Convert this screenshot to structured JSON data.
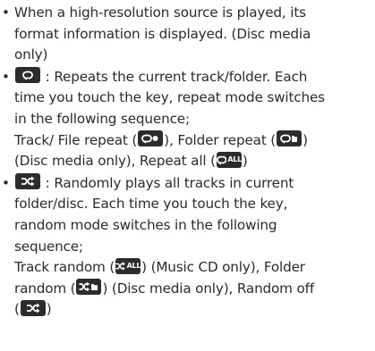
{
  "bullet_char": "•",
  "items": [
    {
      "lines": [
        "When a high-resolution source is played, its",
        "format information is displayed. (Disc media",
        "only)"
      ]
    },
    {
      "line1_after": " : Repeats the current track/folder. Each",
      "line2": "time you touch the key, repeat mode switches",
      "line3": "in the following sequence;",
      "line4_a": "Track/ File repeat (",
      "line4_b": "), Folder repeat (",
      "line4_c": ")",
      "line5_a": "(Disc media only), Repeat all (",
      "line5_b": ")",
      "key_text_all": "ALL"
    },
    {
      "line1_after": " : Randomly plays all tracks in current",
      "line2": "folder/disc. Each time you touch the key,",
      "line3": "random mode switches in the following",
      "line4": "sequence;",
      "line5_a": "Track random (",
      "line5_b": ") (Music CD only), Folder",
      "line6_a": "random (",
      "line6_b": ") (Disc media only), Random off",
      "line7_a": "(",
      "line7_b": ")",
      "key_text_all": "ALL"
    }
  ],
  "icons": {
    "repeat": "repeat-icon",
    "repeat_one": "repeat-one-icon",
    "repeat_folder": "repeat-folder-icon",
    "repeat_all": "repeat-all-icon",
    "random": "random-icon",
    "random_all": "random-all-icon",
    "random_folder": "random-folder-icon",
    "random_off": "random-off-icon"
  },
  "colors": {
    "text": "#2b2b2b",
    "key_bg": "#2c2c2c",
    "key_fg": "#ffffff"
  }
}
